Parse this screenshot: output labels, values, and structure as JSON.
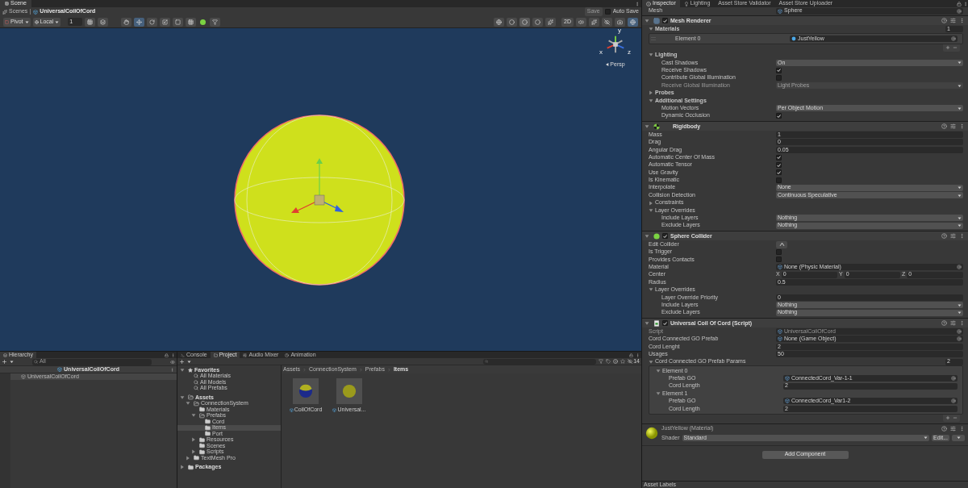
{
  "scene": {
    "tabs": [
      {
        "label": "Scene",
        "selected": true
      }
    ],
    "breadcrumb": [
      "Scenes",
      "UniversalCoilOfCord"
    ],
    "save": "Save",
    "auto_save": {
      "label": "Auto Save",
      "checked": false
    },
    "toolbar": {
      "pivot": "Pivot",
      "space": "Local",
      "grid_value": "1",
      "mode_2d": "2D"
    },
    "gizmo_axes": [
      "y",
      "x",
      "z"
    ],
    "projection": "Persp"
  },
  "hierarchy": {
    "title": "Hierarchy",
    "search_placeholder": "All",
    "header": "UniversalCoilOfCord",
    "items": [
      {
        "label": "UniversalCoilOfCord",
        "selected": true
      }
    ]
  },
  "project": {
    "tabs": [
      {
        "label": "Console",
        "selected": false
      },
      {
        "label": "Project",
        "selected": true
      },
      {
        "label": "Audio Mixer",
        "selected": false
      },
      {
        "label": "Animation",
        "selected": false
      }
    ],
    "tree": [
      {
        "label": "Favorites",
        "kind": "star",
        "expanded": true,
        "selected": false,
        "children": [
          {
            "label": "All Materials",
            "kind": "search",
            "selected": false
          },
          {
            "label": "All Models",
            "kind": "search",
            "selected": false
          },
          {
            "label": "All Prefabs",
            "kind": "search",
            "selected": false
          }
        ]
      },
      {
        "label": "Assets",
        "kind": "folder",
        "expanded": true,
        "selected": false,
        "children": [
          {
            "label": "ConnectionSystem",
            "kind": "folder",
            "expanded": true,
            "selected": false,
            "children": [
              {
                "label": "Materials",
                "kind": "folder",
                "selected": false
              },
              {
                "label": "Prefabs",
                "kind": "folder",
                "expanded": true,
                "selected": false,
                "children": [
                  {
                    "label": "Cord",
                    "kind": "folder",
                    "selected": false
                  },
                  {
                    "label": "Items",
                    "kind": "folder",
                    "selected": true
                  },
                  {
                    "label": "Port",
                    "kind": "folder",
                    "selected": false
                  }
                ]
              },
              {
                "label": "Resources",
                "kind": "folder",
                "expanded": false,
                "selected": false
              },
              {
                "label": "Scenes",
                "kind": "folder",
                "selected": false
              },
              {
                "label": "Scripts",
                "kind": "folder",
                "expanded": false,
                "selected": false
              }
            ]
          },
          {
            "label": "TextMesh Pro",
            "kind": "folder",
            "expanded": false,
            "selected": false
          }
        ]
      },
      {
        "label": "Packages",
        "kind": "folder",
        "expanded": false,
        "selected": false
      }
    ],
    "breadcrumb": [
      "Assets",
      "ConnectionSystem",
      "Prefabs",
      "Items"
    ],
    "hidden_count": "14",
    "assets": [
      {
        "label": "CoilOfCord",
        "kind": "twotone"
      },
      {
        "label": "Universal...",
        "kind": "plain"
      }
    ]
  },
  "inspector": {
    "tabs": [
      {
        "label": "Inspector",
        "selected": true
      },
      {
        "label": "Lighting",
        "selected": false
      },
      {
        "label": "Asset Store Validator",
        "selected": false
      },
      {
        "label": "Asset Store Uploader",
        "selected": false
      }
    ],
    "top_rows": [
      {
        "kind": "object",
        "label": "Mesh",
        "value": "Sphere"
      }
    ],
    "components": [
      {
        "title": "Mesh Renderer",
        "kind": "renderer",
        "enabled": true,
        "expanded": true,
        "rows": [
          {
            "kind": "foldout",
            "label": "Materials",
            "expanded": true,
            "count": "1",
            "children": [
              {
                "kind": "element",
                "label": "Element 0",
                "value": "JustYellow"
              }
            ]
          },
          {
            "kind": "foldout",
            "label": "Lighting",
            "expanded": true,
            "children": [
              {
                "kind": "dropdown",
                "label": "Cast Shadows",
                "value": "On",
                "disabled": false
              },
              {
                "kind": "checkbox",
                "label": "Receive Shadows",
                "checked": true
              },
              {
                "kind": "checkbox",
                "label": "Contribute Global Illumination",
                "checked": false
              },
              {
                "kind": "dropdown",
                "label": "Receive Global Illumination",
                "value": "Light Probes",
                "disabled": true
              }
            ]
          },
          {
            "kind": "foldout",
            "label": "Probes",
            "expanded": false
          },
          {
            "kind": "foldout",
            "label": "Additional Settings",
            "expanded": true,
            "children": [
              {
                "kind": "dropdown",
                "label": "Motion Vectors",
                "value": "Per Object Motion",
                "disabled": false
              },
              {
                "kind": "checkbox",
                "label": "Dynamic Occlusion",
                "checked": true
              }
            ]
          }
        ]
      },
      {
        "title": "Rigidbody",
        "kind": "rigidbody",
        "expanded": true,
        "rows": [
          {
            "kind": "text",
            "label": "Mass",
            "value": "1"
          },
          {
            "kind": "text",
            "label": "Drag",
            "value": "0"
          },
          {
            "kind": "text",
            "label": "Angular Drag",
            "value": "0.05"
          },
          {
            "kind": "checkbox",
            "label": "Automatic Center Of Mass",
            "checked": true
          },
          {
            "kind": "checkbox",
            "label": "Automatic Tensor",
            "checked": true
          },
          {
            "kind": "checkbox",
            "label": "Use Gravity",
            "checked": true
          },
          {
            "kind": "checkbox",
            "label": "Is Kinematic",
            "checked": false
          },
          {
            "kind": "dropdown",
            "label": "Interpolate",
            "value": "None",
            "disabled": false
          },
          {
            "kind": "dropdown",
            "label": "Collision Detection",
            "value": "Continuous Speculative",
            "disabled": false
          },
          {
            "kind": "foldout",
            "label": "Constraints",
            "expanded": false
          },
          {
            "kind": "foldout",
            "label": "Layer Overrides",
            "expanded": true,
            "children": [
              {
                "kind": "dropdown",
                "label": "Include Layers",
                "value": "Nothing",
                "disabled": false
              },
              {
                "kind": "dropdown",
                "label": "Exclude Layers",
                "value": "Nothing",
                "disabled": false
              }
            ]
          }
        ]
      },
      {
        "title": "Sphere Collider",
        "kind": "collider",
        "enabled": true,
        "expanded": true,
        "rows": [
          {
            "kind": "tool",
            "label": "Edit Collider"
          },
          {
            "kind": "checkbox",
            "label": "Is Trigger",
            "checked": false
          },
          {
            "kind": "checkbox",
            "label": "Provides Contacts",
            "checked": false
          },
          {
            "kind": "object",
            "label": "Material",
            "value": "None (Physic Material)"
          },
          {
            "kind": "vector",
            "label": "Center",
            "axes": [
              {
                "label": "X",
                "value": "0"
              },
              {
                "label": "Y",
                "value": "0"
              },
              {
                "label": "Z",
                "value": "0"
              }
            ]
          },
          {
            "kind": "text",
            "label": "Radius",
            "value": "0.5"
          },
          {
            "kind": "foldout",
            "label": "Layer Overrides",
            "expanded": true,
            "children": [
              {
                "kind": "text",
                "label": "Layer Override Priority",
                "value": "0"
              },
              {
                "kind": "dropdown",
                "label": "Include Layers",
                "value": "Nothing",
                "disabled": false
              },
              {
                "kind": "dropdown",
                "label": "Exclude Layers",
                "value": "Nothing",
                "disabled": false
              }
            ]
          }
        ]
      },
      {
        "title": "Universal Coil Of Cord (Script)",
        "kind": "script",
        "enabled": true,
        "expanded": true,
        "rows": [
          {
            "kind": "object",
            "label": "Script",
            "value": "UniversalCoilOfCord",
            "disabled": true
          },
          {
            "kind": "object",
            "label": "Cord Connected GO Prefab",
            "value": "None (Game Object)"
          },
          {
            "kind": "text",
            "label": "Cord Lenght",
            "value": "2"
          },
          {
            "kind": "text",
            "label": "Usages",
            "value": "50"
          },
          {
            "kind": "foldout",
            "label": "Cord Connected GO Prefab Params",
            "expanded": true,
            "count": "2",
            "children": [
              {
                "kind": "foldout",
                "label": "Element 0",
                "expanded": true,
                "children": [
                  {
                    "kind": "object",
                    "label": "Prefab GO",
                    "value": "ConnectedCord_Var-1-1"
                  },
                  {
                    "kind": "text",
                    "label": "Cord Length",
                    "value": "2"
                  }
                ]
              },
              {
                "kind": "foldout",
                "label": "Element 1",
                "expanded": true,
                "children": [
                  {
                    "kind": "object",
                    "label": "Prefab GO",
                    "value": "ConnectedCord_Var1-2"
                  },
                  {
                    "kind": "text",
                    "label": "Cord Length",
                    "value": "2"
                  }
                ]
              }
            ]
          }
        ]
      }
    ],
    "material": {
      "name": "JustYellow (Material)",
      "shader_label": "Shader",
      "shader": "Standard",
      "edit_button": "Edit..."
    },
    "add_component": "Add Component",
    "asset_labels": "Asset Labels"
  }
}
